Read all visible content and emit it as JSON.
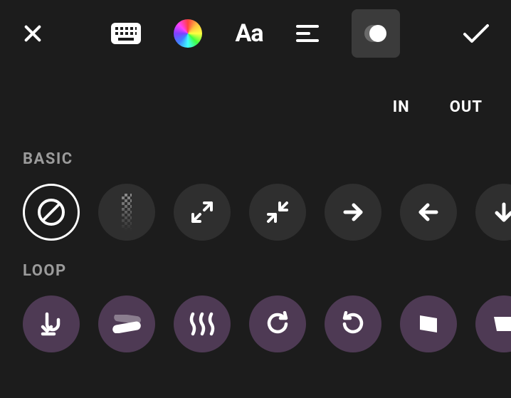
{
  "topbar": {
    "close": "close",
    "keyboard": "keyboard",
    "color": "color-wheel",
    "font": "Aa",
    "align": "align",
    "effects": "effects",
    "confirm": "confirm"
  },
  "tabs": {
    "in": "IN",
    "out": "OUT",
    "active": "in"
  },
  "sections": {
    "basic": "BASIC",
    "loop": "LOOP"
  },
  "basic_effects": [
    {
      "name": "none",
      "selected": true
    },
    {
      "name": "fade"
    },
    {
      "name": "zoom-in"
    },
    {
      "name": "zoom-out"
    },
    {
      "name": "slide-right"
    },
    {
      "name": "slide-left"
    },
    {
      "name": "slide-down"
    }
  ],
  "loop_effects": [
    {
      "name": "bounce"
    },
    {
      "name": "swing"
    },
    {
      "name": "wave"
    },
    {
      "name": "spin-cw"
    },
    {
      "name": "spin-ccw"
    },
    {
      "name": "sway"
    },
    {
      "name": "more"
    }
  ]
}
